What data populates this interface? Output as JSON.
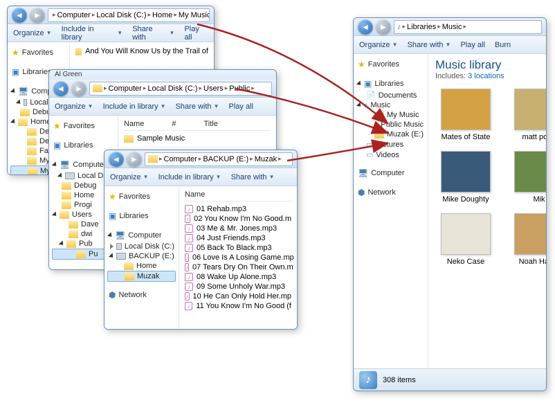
{
  "win1": {
    "crumbs": [
      "Computer",
      "Local Disk (C:)",
      "Home",
      "My Music"
    ],
    "toolbar": {
      "organize": "Organize",
      "include": "Include in library",
      "share": "Share with",
      "play": "Play all"
    },
    "nav": {
      "favorites": "Favorites",
      "libraries": "Libraries",
      "computer": "Computer"
    },
    "tree": {
      "computer": "Computer",
      "localdisk": "Local Disk",
      "items": [
        "Debug",
        "Home",
        "Desi",
        "Devi",
        "Favi",
        "My",
        "My",
        "My"
      ]
    },
    "row1": "And You Will Know Us by the Trail of"
  },
  "win2": {
    "crumbs": [
      "Computer",
      "Local Disk (C:)",
      "Users",
      "Public"
    ],
    "toolbar": {
      "organize": "Organize",
      "include": "Include in library",
      "share": "Share with",
      "play": "Play all"
    },
    "nav": {
      "favorites": "Favorites",
      "libraries": "Libraries",
      "computer": "Computer"
    },
    "headers": {
      "name": "Name",
      "num": "#",
      "title": "Title"
    },
    "row": "Sample Music",
    "title_text": "Al Green",
    "tree": {
      "computer": "Computer",
      "localdisk": "Local Disk",
      "items": [
        "Debug",
        "Home",
        "Progi",
        "Users"
      ],
      "subusers": [
        "Dave",
        "dwi",
        "Pub"
      ],
      "pubchild": "Pu"
    }
  },
  "win3": {
    "crumbs": [
      "Computer",
      "BACKUP (E:)",
      "Muzak"
    ],
    "toolbar": {
      "organize": "Organize",
      "include": "Include in library",
      "share": "Share with"
    },
    "nav": {
      "favorites": "Favorites",
      "libraries": "Libraries",
      "computer": "Computer",
      "localdisk": "Local Disk (C:)",
      "backup": "BACKUP (E:)",
      "home": "Home",
      "muzak": "Muzak",
      "network": "Network"
    },
    "header": "Name",
    "files": [
      "01 Rehab.mp3",
      "02 You Know I'm No Good.m",
      "03 Me & Mr. Jones.mp3",
      "04 Just Friends.mp3",
      "05 Back To Black.mp3",
      "06 Love Is A Losing Game.mp",
      "07 Tears Dry On Their Own.m",
      "08 Wake Up Alone.mp3",
      "09 Some Unholy War.mp3",
      "10 He Can Only Hold Her.mp",
      "11 You Know I'm No Good (f"
    ]
  },
  "winlib": {
    "crumbs": [
      "Libraries",
      "Music"
    ],
    "toolbar": {
      "organize": "Organize",
      "share": "Share with",
      "play": "Play all",
      "burn": "Burn"
    },
    "nav": {
      "favorites": "Favorites",
      "libraries": "Libraries",
      "documents": "Documents",
      "music": "Music",
      "mymusic": "My Music",
      "publicmusic": "Public Music",
      "muzak": "Muzak (E:)",
      "pictures": "Pictures",
      "videos": "Videos",
      "computer": "Computer",
      "network": "Network"
    },
    "lib_title": "Music library",
    "lib_includes_label": "Includes:",
    "lib_includes_link": "3 locations",
    "albums": [
      "Mates of State",
      "matt pond",
      "Mike Doughty",
      "Mik",
      "Neko Case",
      "Noah Harris"
    ],
    "status_count": "308 items"
  }
}
